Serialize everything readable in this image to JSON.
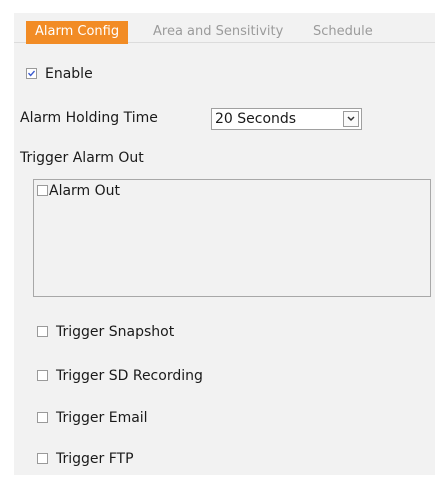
{
  "tabs": [
    {
      "label": "Alarm Config",
      "active": true
    },
    {
      "label": "Area and Sensitivity",
      "active": false
    },
    {
      "label": "Schedule",
      "active": false
    }
  ],
  "enable": {
    "label": "Enable",
    "checked": true
  },
  "holding_time": {
    "label": "Alarm Holding Time",
    "value": "20 Seconds"
  },
  "trigger_alarm_out": {
    "label": "Trigger Alarm Out",
    "items": [
      {
        "label": "Alarm Out",
        "checked": false
      }
    ]
  },
  "triggers": [
    {
      "label": "Trigger Snapshot",
      "checked": false
    },
    {
      "label": "Trigger SD Recording",
      "checked": false
    },
    {
      "label": "Trigger Email",
      "checked": false
    },
    {
      "label": "Trigger FTP",
      "checked": false
    }
  ],
  "colors": {
    "accent": "#f28c25",
    "panel": "#f2f2f2",
    "check": "#3b5bcf"
  }
}
